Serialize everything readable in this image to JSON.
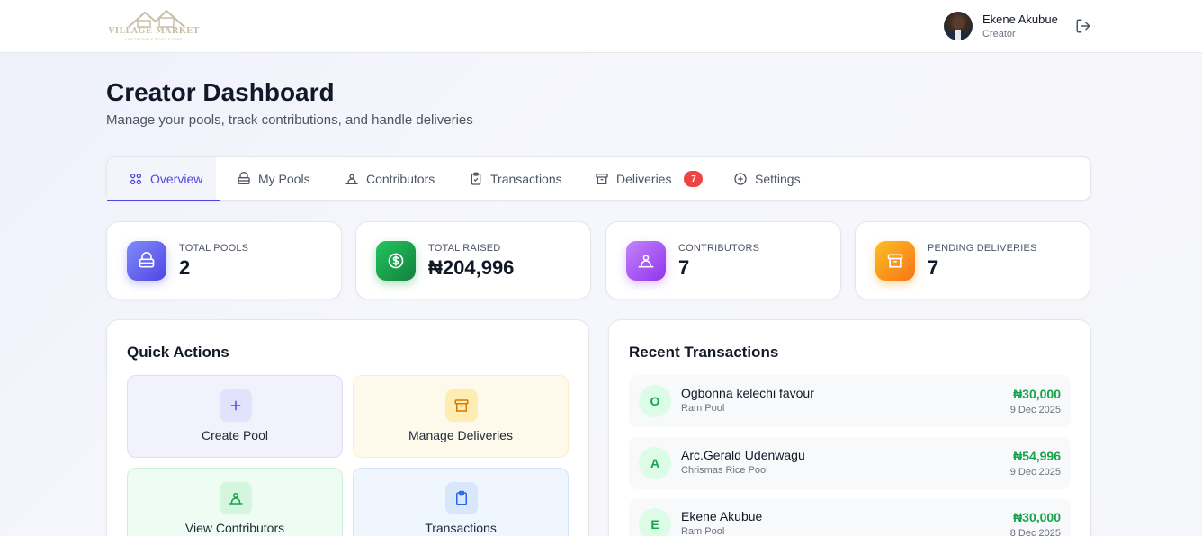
{
  "header": {
    "logo_text": "VILLAGE MARKET",
    "logo_sub": "AFFORDABLE POOL STORE",
    "user_name": "Ekene Akubue",
    "user_role": "Creator"
  },
  "page": {
    "title": "Creator Dashboard",
    "subtitle": "Manage your pools, track contributions, and handle deliveries"
  },
  "tabs": [
    {
      "label": "Overview",
      "icon": "grid-icon",
      "active": true
    },
    {
      "label": "My Pools",
      "icon": "pool-icon"
    },
    {
      "label": "Contributors",
      "icon": "users-icon"
    },
    {
      "label": "Transactions",
      "icon": "clipboard-icon"
    },
    {
      "label": "Deliveries",
      "icon": "archive-icon",
      "badge": "7"
    },
    {
      "label": "Settings",
      "icon": "plus-circle-icon"
    }
  ],
  "stats": [
    {
      "label": "TOTAL POOLS",
      "value": "2",
      "icon": "pool-icon",
      "color": "#6366f1"
    },
    {
      "label": "TOTAL RAISED",
      "value": "₦204,996",
      "icon": "dollar-icon",
      "color": "#16a34a"
    },
    {
      "label": "CONTRIBUTORS",
      "value": "7",
      "icon": "users-icon",
      "color": "#a855f7"
    },
    {
      "label": "PENDING DELIVERIES",
      "value": "7",
      "icon": "archive-icon",
      "color": "#f59e0b"
    }
  ],
  "quick_actions": {
    "title": "Quick Actions",
    "items": [
      {
        "label": "Create Pool",
        "icon": "plus-icon"
      },
      {
        "label": "Manage Deliveries",
        "icon": "archive-icon"
      },
      {
        "label": "View Contributors",
        "icon": "users-icon"
      },
      {
        "label": "Transactions",
        "icon": "clipboard-icon"
      }
    ]
  },
  "recent_transactions": {
    "title": "Recent Transactions",
    "items": [
      {
        "initial": "O",
        "name": "Ogbonna kelechi favour",
        "pool": "Ram Pool",
        "amount": "₦30,000",
        "date": "9 Dec 2025"
      },
      {
        "initial": "A",
        "name": "Arc.Gerald Udenwagu",
        "pool": "Chrismas Rice Pool",
        "amount": "₦54,996",
        "date": "9 Dec 2025"
      },
      {
        "initial": "E",
        "name": "Ekene Akubue",
        "pool": "Ram Pool",
        "amount": "₦30,000",
        "date": "8 Dec 2025"
      }
    ]
  }
}
